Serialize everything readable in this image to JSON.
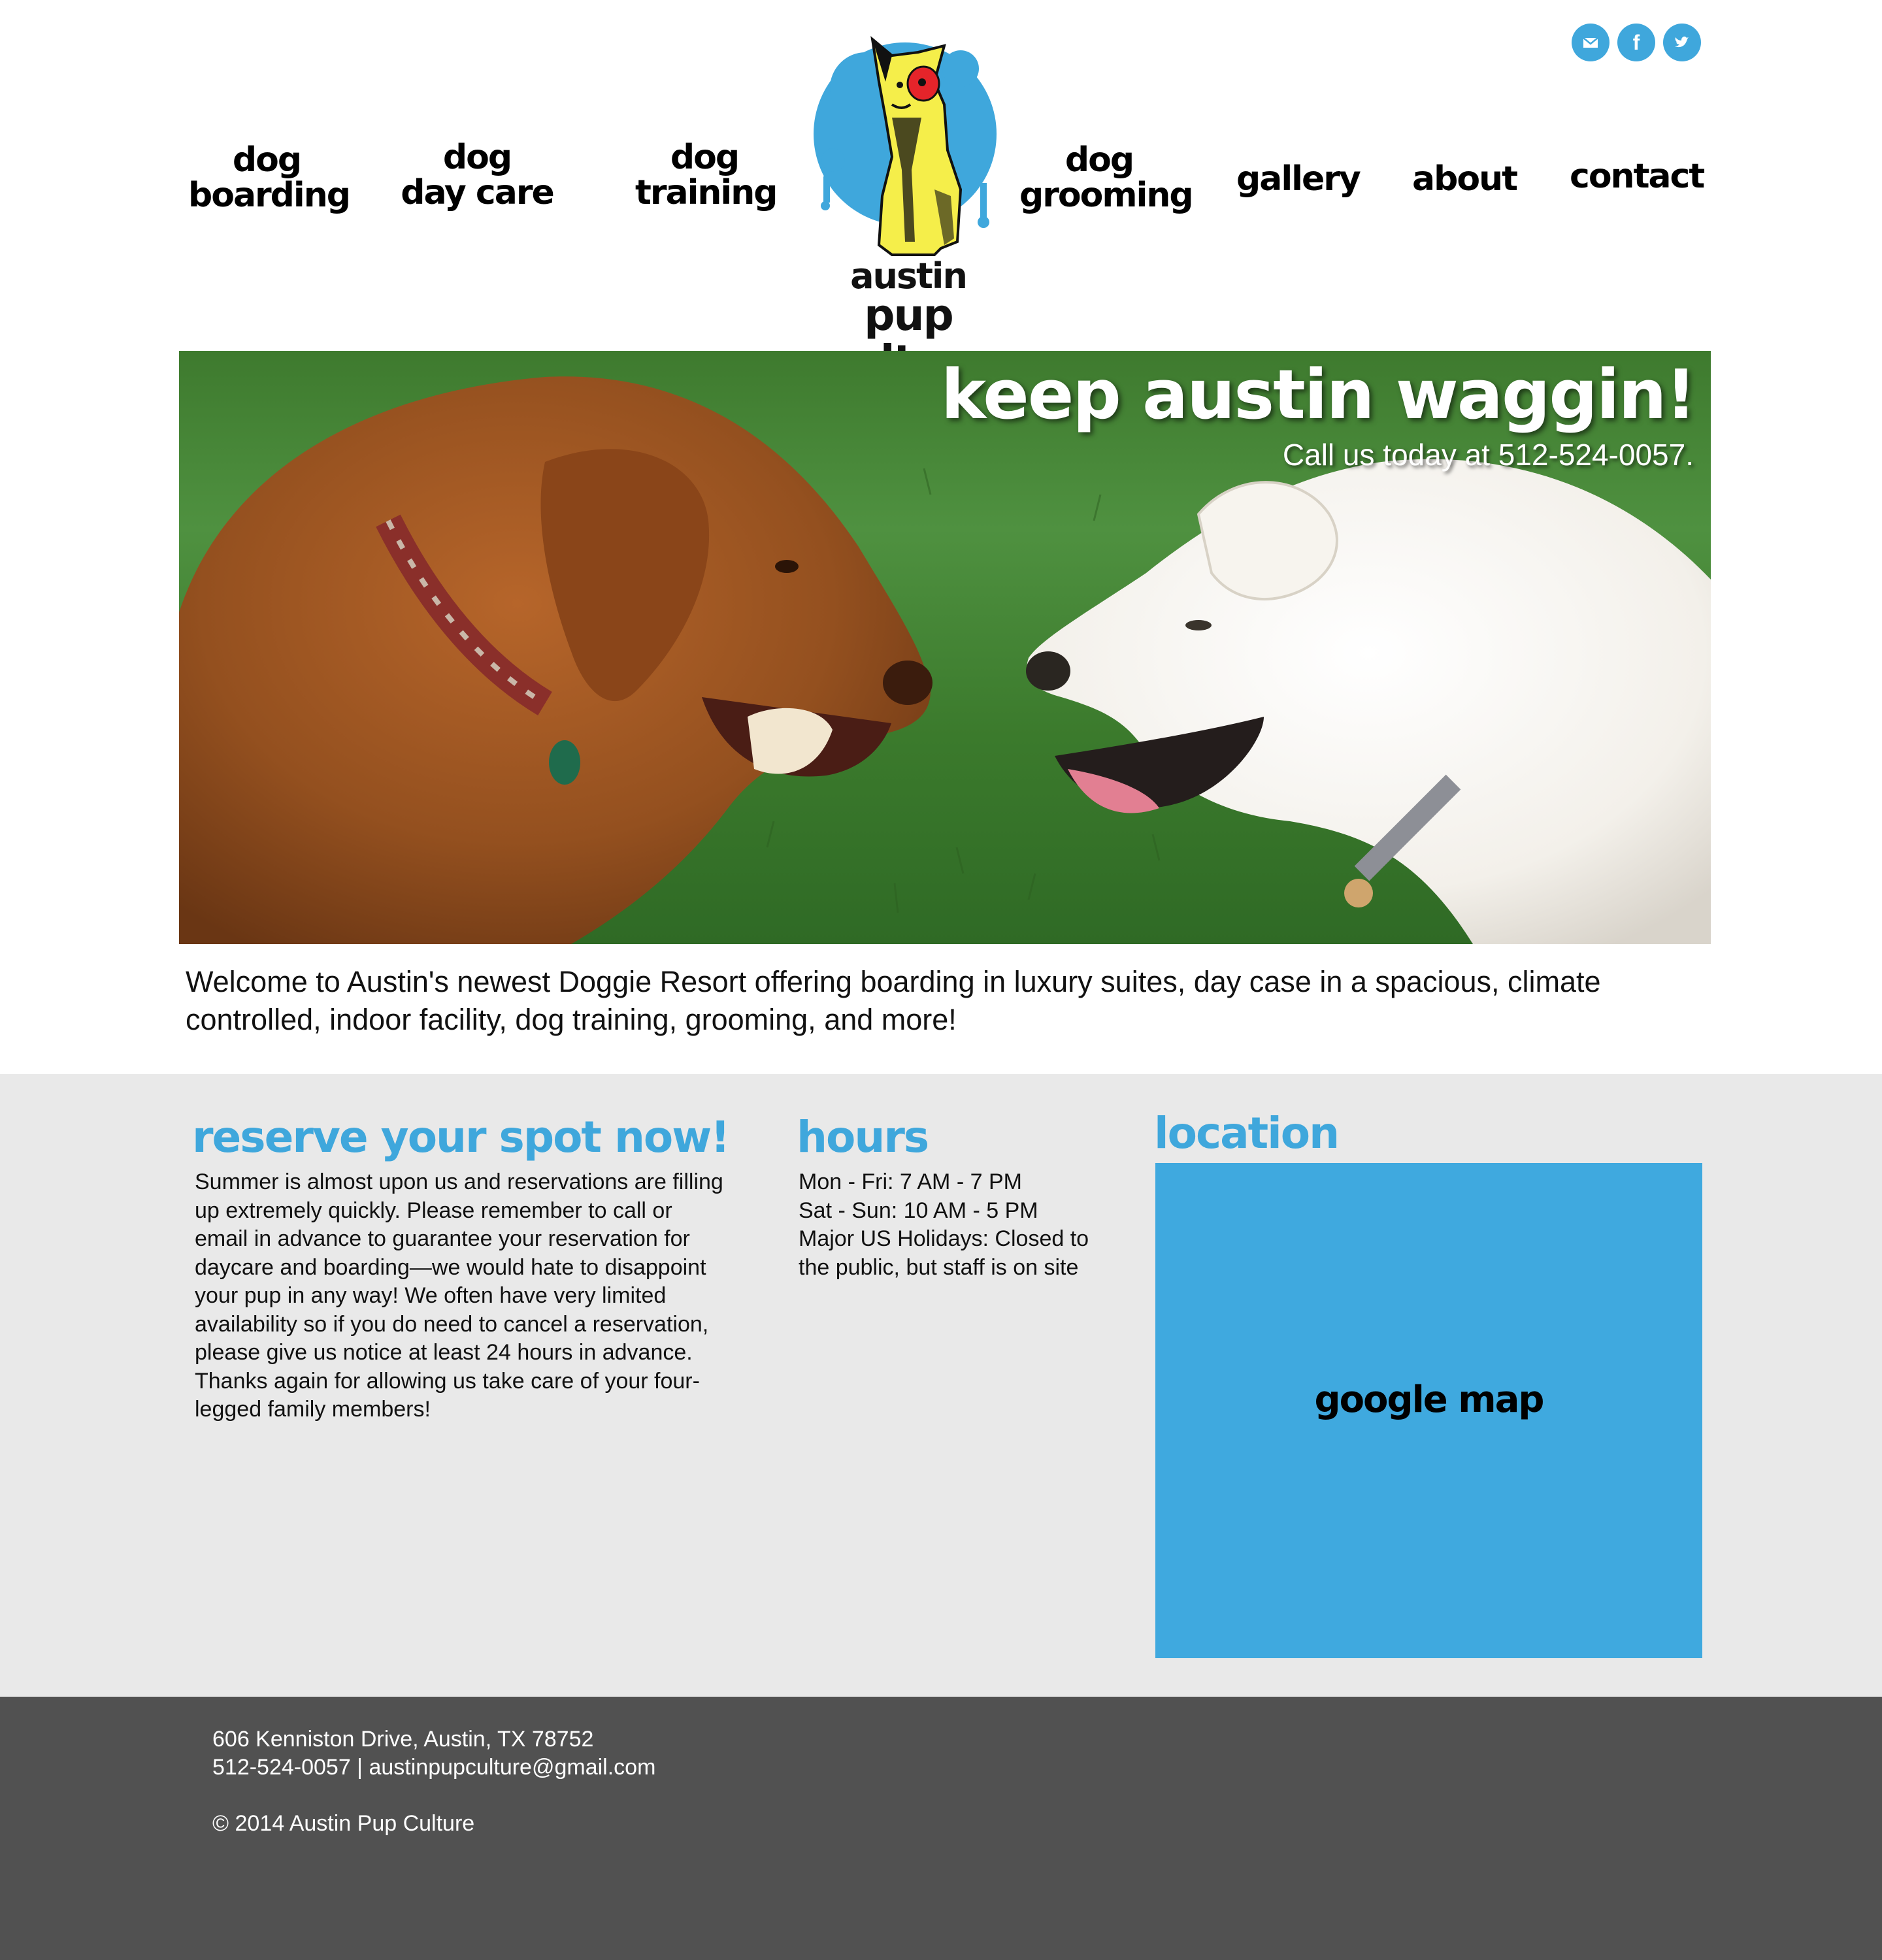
{
  "social": {
    "email_icon": "email-icon",
    "facebook_icon": "facebook-icon",
    "twitter_icon": "twitter-icon",
    "facebook_glyph": "f",
    "accent_color": "#3fa7dc"
  },
  "nav": {
    "left": [
      {
        "line1": "dog",
        "line2": "boarding"
      },
      {
        "line1": "dog",
        "line2": "day care"
      },
      {
        "line1": "dog",
        "line2": "training"
      }
    ],
    "right": [
      {
        "line1": "dog",
        "line2": "grooming"
      },
      {
        "line1": "gallery"
      },
      {
        "line1": "about"
      },
      {
        "line1": "contact"
      }
    ]
  },
  "logo": {
    "line1": "austin",
    "line2": "pup culture"
  },
  "hero": {
    "tagline": "keep austin waggin!",
    "call": "Call us today at 512-524-0057."
  },
  "welcome": "Welcome to Austin's newest Doggie Resort offering boarding in luxury suites, day case in a spacious, climate controlled, indoor facility, dog training, grooming, and more!",
  "reserve": {
    "title": "reserve your spot now!",
    "body": "Summer is almost upon us and reservations are filling up extremely quickly. Please remember to call or email in advance to guarantee your reservation for daycare and boarding—we would hate to disappoint your pup in any way! We often have very limited availability so if you do need to cancel a reservation, please give us notice at least 24 hours in advance. Thanks again for allowing us take care of your four-legged family members!"
  },
  "hours": {
    "title": "hours",
    "lines": [
      "Mon - Fri: 7 AM - 7 PM",
      "Sat - Sun: 10 AM - 5 PM",
      "Major US Holidays: Closed to",
      "the public, but staff is on site"
    ]
  },
  "location": {
    "title": "location",
    "map_label": "google map",
    "map_color": "#3fa9df"
  },
  "footer": {
    "address": "606 Kenniston Drive, Austin, TX 78752",
    "contact": "512-524-0057 | austinpupculture@gmail.com",
    "copyright": "© 2014 Austin Pup Culture"
  }
}
